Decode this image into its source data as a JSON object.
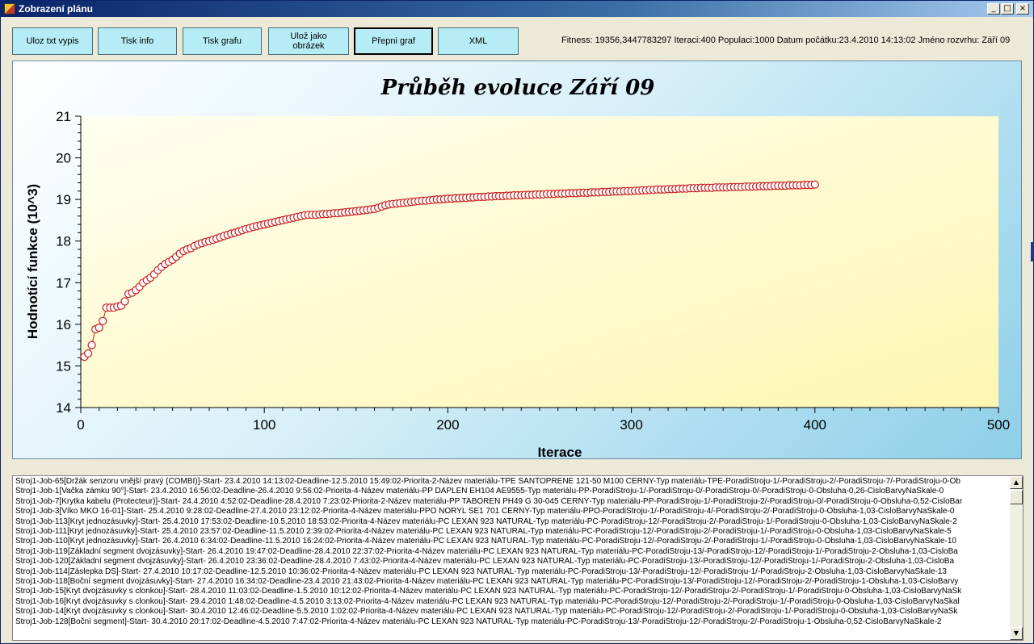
{
  "window": {
    "title": "Zobrazení plánu",
    "controls": {
      "minimize": "_",
      "maximize": "□",
      "close": "×"
    }
  },
  "toolbar": {
    "buttons": [
      {
        "label": "Uloz txt vypis"
      },
      {
        "label": "Tisk info"
      },
      {
        "label": "Tisk grafu"
      },
      {
        "label": "Ulož jako obrázek"
      },
      {
        "label": "Přepni graf"
      },
      {
        "label": "XML"
      }
    ],
    "status": "Fitness: 19356,3447783297 Iteraci:400 Populaci:1000 Datum počátku:23.4.2010 14:13:02 Jméno rozvrhu: Září 09"
  },
  "colors": {
    "button_bg": "#b5ecf5",
    "marker_stroke": "#c81e1e",
    "plot_bg_start": "#fffff0",
    "plot_bg_end": "#fdf6b2"
  },
  "chart_data": {
    "type": "scatter",
    "title": "Průběh evoluce Září 09",
    "xlabel": "Iterace",
    "ylabel": "Hodnotící funkce (10^3)",
    "xlim": [
      0,
      500
    ],
    "ylim": [
      14,
      21
    ],
    "xticks": [
      "0",
      "100",
      "200",
      "300",
      "400",
      "500"
    ],
    "yticks": [
      "14",
      "15",
      "16",
      "17",
      "18",
      "19",
      "20",
      "21"
    ],
    "grid": false,
    "series": [
      {
        "points": [
          [
            2,
            15.22
          ],
          [
            4,
            15.3
          ],
          [
            6,
            15.5
          ],
          [
            8,
            15.88
          ],
          [
            10,
            15.92
          ],
          [
            12,
            16.08
          ],
          [
            14,
            16.4
          ],
          [
            16,
            16.4
          ],
          [
            18,
            16.4
          ],
          [
            20,
            16.43
          ],
          [
            22,
            16.45
          ],
          [
            24,
            16.55
          ],
          [
            26,
            16.73
          ],
          [
            28,
            16.76
          ],
          [
            30,
            16.82
          ],
          [
            32,
            16.9
          ],
          [
            34,
            17.0
          ],
          [
            36,
            17.06
          ],
          [
            38,
            17.12
          ],
          [
            40,
            17.2
          ],
          [
            42,
            17.3
          ],
          [
            44,
            17.38
          ],
          [
            46,
            17.45
          ],
          [
            48,
            17.5
          ],
          [
            50,
            17.55
          ],
          [
            52,
            17.62
          ],
          [
            54,
            17.7
          ],
          [
            56,
            17.76
          ],
          [
            58,
            17.8
          ],
          [
            60,
            17.83
          ],
          [
            62,
            17.88
          ],
          [
            64,
            17.92
          ],
          [
            66,
            17.95
          ],
          [
            68,
            17.98
          ],
          [
            70,
            18.0
          ],
          [
            72,
            18.03
          ],
          [
            74,
            18.06
          ],
          [
            76,
            18.09
          ],
          [
            78,
            18.12
          ],
          [
            80,
            18.15
          ],
          [
            82,
            18.18
          ],
          [
            84,
            18.2
          ],
          [
            86,
            18.23
          ],
          [
            88,
            18.26
          ],
          [
            90,
            18.29
          ],
          [
            92,
            18.31
          ],
          [
            94,
            18.34
          ],
          [
            96,
            18.36
          ],
          [
            98,
            18.38
          ],
          [
            100,
            18.4
          ],
          [
            102,
            18.42
          ],
          [
            104,
            18.44
          ],
          [
            106,
            18.46
          ],
          [
            108,
            18.48
          ],
          [
            110,
            18.5
          ],
          [
            112,
            18.52
          ],
          [
            114,
            18.54
          ],
          [
            116,
            18.56
          ],
          [
            118,
            18.58
          ],
          [
            120,
            18.6
          ],
          [
            122,
            18.62
          ],
          [
            124,
            18.63
          ],
          [
            126,
            18.63
          ],
          [
            128,
            18.63
          ],
          [
            130,
            18.64
          ],
          [
            132,
            18.65
          ],
          [
            134,
            18.65
          ],
          [
            136,
            18.66
          ],
          [
            138,
            18.67
          ],
          [
            140,
            18.67
          ],
          [
            142,
            18.68
          ],
          [
            144,
            18.69
          ],
          [
            146,
            18.7
          ],
          [
            148,
            18.71
          ],
          [
            150,
            18.72
          ],
          [
            152,
            18.73
          ],
          [
            154,
            18.74
          ],
          [
            156,
            18.75
          ],
          [
            158,
            18.76
          ],
          [
            160,
            18.77
          ],
          [
            162,
            18.8
          ],
          [
            164,
            18.83
          ],
          [
            166,
            18.86
          ],
          [
            168,
            18.88
          ],
          [
            170,
            18.89
          ],
          [
            172,
            18.9
          ],
          [
            174,
            18.91
          ],
          [
            176,
            18.92
          ],
          [
            178,
            18.93
          ],
          [
            180,
            18.94
          ],
          [
            182,
            18.95
          ],
          [
            184,
            18.96
          ],
          [
            186,
            18.97
          ],
          [
            188,
            18.97
          ],
          [
            190,
            18.98
          ],
          [
            192,
            18.99
          ],
          [
            194,
            19.0
          ],
          [
            196,
            19.0
          ],
          [
            198,
            19.01
          ],
          [
            200,
            19.02
          ],
          [
            202,
            19.02
          ],
          [
            204,
            19.03
          ],
          [
            206,
            19.03
          ],
          [
            208,
            19.04
          ],
          [
            210,
            19.04
          ],
          [
            212,
            19.05
          ],
          [
            214,
            19.05
          ],
          [
            216,
            19.06
          ],
          [
            218,
            19.06
          ],
          [
            220,
            19.06
          ],
          [
            222,
            19.07
          ],
          [
            224,
            19.07
          ],
          [
            226,
            19.08
          ],
          [
            228,
            19.08
          ],
          [
            230,
            19.08
          ],
          [
            232,
            19.09
          ],
          [
            234,
            19.09
          ],
          [
            236,
            19.1
          ],
          [
            238,
            19.1
          ],
          [
            240,
            19.1
          ],
          [
            242,
            19.11
          ],
          [
            244,
            19.11
          ],
          [
            246,
            19.11
          ],
          [
            248,
            19.12
          ],
          [
            250,
            19.12
          ],
          [
            252,
            19.12
          ],
          [
            254,
            19.13
          ],
          [
            256,
            19.13
          ],
          [
            258,
            19.13
          ],
          [
            260,
            19.14
          ],
          [
            262,
            19.14
          ],
          [
            264,
            19.14
          ],
          [
            266,
            19.15
          ],
          [
            268,
            19.15
          ],
          [
            270,
            19.15
          ],
          [
            272,
            19.16
          ],
          [
            274,
            19.16
          ],
          [
            276,
            19.16
          ],
          [
            278,
            19.17
          ],
          [
            280,
            19.17
          ],
          [
            282,
            19.17
          ],
          [
            284,
            19.18
          ],
          [
            286,
            19.18
          ],
          [
            288,
            19.18
          ],
          [
            290,
            19.19
          ],
          [
            292,
            19.19
          ],
          [
            294,
            19.19
          ],
          [
            296,
            19.2
          ],
          [
            298,
            19.2
          ],
          [
            300,
            19.2
          ],
          [
            302,
            19.21
          ],
          [
            304,
            19.21
          ],
          [
            306,
            19.22
          ],
          [
            308,
            19.22
          ],
          [
            310,
            19.23
          ],
          [
            312,
            19.23
          ],
          [
            314,
            19.24
          ],
          [
            316,
            19.24
          ],
          [
            318,
            19.24
          ],
          [
            320,
            19.25
          ],
          [
            322,
            19.25
          ],
          [
            324,
            19.25
          ],
          [
            326,
            19.26
          ],
          [
            328,
            19.26
          ],
          [
            330,
            19.26
          ],
          [
            332,
            19.27
          ],
          [
            334,
            19.27
          ],
          [
            336,
            19.27
          ],
          [
            338,
            19.28
          ],
          [
            340,
            19.28
          ],
          [
            342,
            19.28
          ],
          [
            344,
            19.28
          ],
          [
            346,
            19.29
          ],
          [
            348,
            19.29
          ],
          [
            350,
            19.29
          ],
          [
            352,
            19.29
          ],
          [
            354,
            19.3
          ],
          [
            356,
            19.3
          ],
          [
            358,
            19.3
          ],
          [
            360,
            19.3
          ],
          [
            362,
            19.31
          ],
          [
            364,
            19.31
          ],
          [
            366,
            19.31
          ],
          [
            368,
            19.31
          ],
          [
            370,
            19.32
          ],
          [
            372,
            19.32
          ],
          [
            374,
            19.32
          ],
          [
            376,
            19.32
          ],
          [
            378,
            19.33
          ],
          [
            380,
            19.33
          ],
          [
            382,
            19.33
          ],
          [
            384,
            19.33
          ],
          [
            386,
            19.34
          ],
          [
            388,
            19.34
          ],
          [
            390,
            19.34
          ],
          [
            392,
            19.34
          ],
          [
            394,
            19.35
          ],
          [
            396,
            19.35
          ],
          [
            398,
            19.35
          ],
          [
            400,
            19.36
          ]
        ]
      }
    ]
  },
  "log": {
    "lines": [
      "Stroj1-Job-65[Držák senzoru vnější pravý (COMBI)]-Start- 23.4.2010 14:13:02-Deadline-12.5.2010 15:49:02-Priorita-2-Název materiálu-TPE SANTOPRENE 121-50 M100 CERNY-Typ materiálu-TPE-PoradiStroju-1/-PoradiStroju-2/-PoradiStroju-7/-PoradiStroju-0-Ob",
      "Stroj1-Job-1[Vačka zámku 90°]-Start- 23.4.2010 16:56:02-Deadline-26.4.2010 9:56:02-Priorita-4-Název materiálu-PP DAPLEN EH104 AE9555-Typ materiálu-PP-PoradiStroju-1/-PoradiStroju-0/-PoradiStroju-0/-PoradiStroju-0-Obsluha-0,26-CisloBarvyNaSkale-0",
      "Stroj1-Job-7[Krytka kabelu (Protecteur)]-Start- 24.4.2010 4:52:02-Deadline-28.4.2010 7:23:02-Priorita-2-Název materiálu-PP TABOREN PH49 G 30-045 ČERNÝ-Typ materiálu-PP-PoradiStroju-1/-PoradiStroju-2/-PoradiStroju-0/-PoradiStroju-0-Obsluha-0,52-CisloBar",
      "Stroj1-Job-3[Víko MKO 16-01]-Start- 25.4.2010 9:28:02-Deadline-27.4.2010 23:12:02-Priorita-4-Název materiálu-PPO NORYL SE1 701 CERNY-Typ materiálu-PPO-PoradiStroju-1/-PoradiStroju-4/-PoradiStroju-2/-PoradiStroju-0-Obsluha-1,03-CisloBarvyNaSkale-0",
      "Stroj1-Job-113[Kryt jednozásuvky]-Start- 25.4.2010 17:53:02-Deadline-10.5.2010 18:53:02-Priorita-4-Název materiálu-PC LEXAN 923 NATURAL-Typ materiálu-PC-PoradiStroju-12/-PoradiStroju-2/-PoradiStroju-1/-PoradiStroju-0-Obsluha-1,03-CisloBarvyNaSkale-2",
      "Stroj1-Job-111[Kryt jednozásuvky]-Start- 25.4.2010 23:57:02-Deadline-11.5.2010 2:39:02-Priorita-4-Název materiálu-PC LEXAN 923 NATURAL-Typ materiálu-PC-PoradiStroju-12/-PoradiStroju-2/-PoradiStroju-1/-PoradiStroju-0-Obsluha-1,03-CisloBarvyNaSkale-5",
      "Stroj1-Job-110[Kryt jednozásuvky]-Start- 26.4.2010 6:34:02-Deadline-11.5.2010 16:24:02-Priorita-4-Název materiálu-PC LEXAN 923 NATURAL-Typ materiálu-PC-PoradiStroju-12/-PoradiStroju-2/-PoradiStroju-1/-PoradiStroju-0-Obsluha-1,03-CisloBarvyNaSkale-10",
      "Stroj1-Job-119[Základní segment dvojzásuvky]-Start- 26.4.2010 19:47:02-Deadline-28.4.2010 22:37:02-Priorita-4-Název materiálu-PC LEXAN 923 NATURAL-Typ materiálu-PC-PoradiStroju-13/-PoradiStroju-12/-PoradiStroju-1/-PoradiStroju-2-Obsluha-1,03-CisloBa",
      "Stroj1-Job-120[Základní segment dvojzásuvky]-Start- 26.4.2010 23:36:02-Deadline-28.4.2010 7:43:02-Priorita-4-Název materiálu-PC LEXAN 923 NATURAL-Typ materiálu-PC-PoradiStroju-13/-PoradiStroju-12/-PoradiStroju-1/-PoradiStroju-2-Obsluha-1,03-CisloBa",
      "Stroj1-Job-114[Záslepka DS]-Start- 27.4.2010 10:17:02-Deadline-12.5.2010 10:36:02-Priorita-4-Název materiálu-PC LEXAN 923 NATURAL-Typ materiálu-PC-PoradiStroju-13/-PoradiStroju-12/-PoradiStroju-1/-PoradiStroju-2-Obsluha-1,03-CisloBarvyNaSkale-13",
      "Stroj1-Job-118[Boční segment dvojzásuvky]-Start- 27.4.2010 16:34:02-Deadline-23.4.2010 21:43:02-Priorita-4-Název materiálu-PC LEXAN 923 NATURAL-Typ materiálu-PC-PoradiStroju-13/-PoradiStroju-12/-PoradiStroju-2/-PoradiStroju-1-Obsluha-1,03-CisloBarvy",
      "Stroj1-Job-15[Kryt dvojzásuvky s clonkou]-Start- 28.4.2010 11:03:02-Deadline-1.5.2010 10:12:02-Priorita-4-Název materiálu-PC LEXAN 923 NATURAL-Typ materiálu-PC-PoradiStroju-12/-PoradiStroju-2/-PoradiStroju-1/-PoradiStroju-0-Obsluha-1,03-CisloBarvyNaSk",
      "Stroj1-Job-16[Kryt dvojzásuvky s clonkou]-Start- 29.4.2010 1:48:02-Deadline-4.5.2010 3:13:02-Priorita-4-Název materiálu-PC LEXAN 923 NATURAL-Typ materiálu-PC-PoradiStroju-12/-PoradiStroju-2/-PoradiStroju-1/-PoradiStroju-0-Obsluha-1,03-CisloBarvyNaSkal",
      "Stroj1-Job-14[Kryt dvojzásuvky s clonkou]-Start- 30.4.2010 12:46:02-Deadline-5.5.2010 1:02:02-Priorita-4-Název materiálu-PC LEXAN 923 NATURAL-Typ materiálu-PC-PoradiStroju-12/-PoradiStroju-2/-PoradiStroju-1/-PoradiStroju-0-Obsluha-1,03-CisloBarvyNaSk",
      "Stroj1-Job-128[Boční segment]-Start- 30.4.2010 20:17:02-Deadline-4.5.2010 7:47:02-Priorita-4-Název materiálu-PC LEXAN 923 NATURAL-Typ materiálu-PC-PoradiStroju-13/-PoradiStroju-12/-PoradiStroju-2/-PoradiStroju-1-Obsluha-0,52-CisloBarvyNaSkale-2"
    ],
    "scroll_up": "▲",
    "scroll_down": "▼"
  }
}
